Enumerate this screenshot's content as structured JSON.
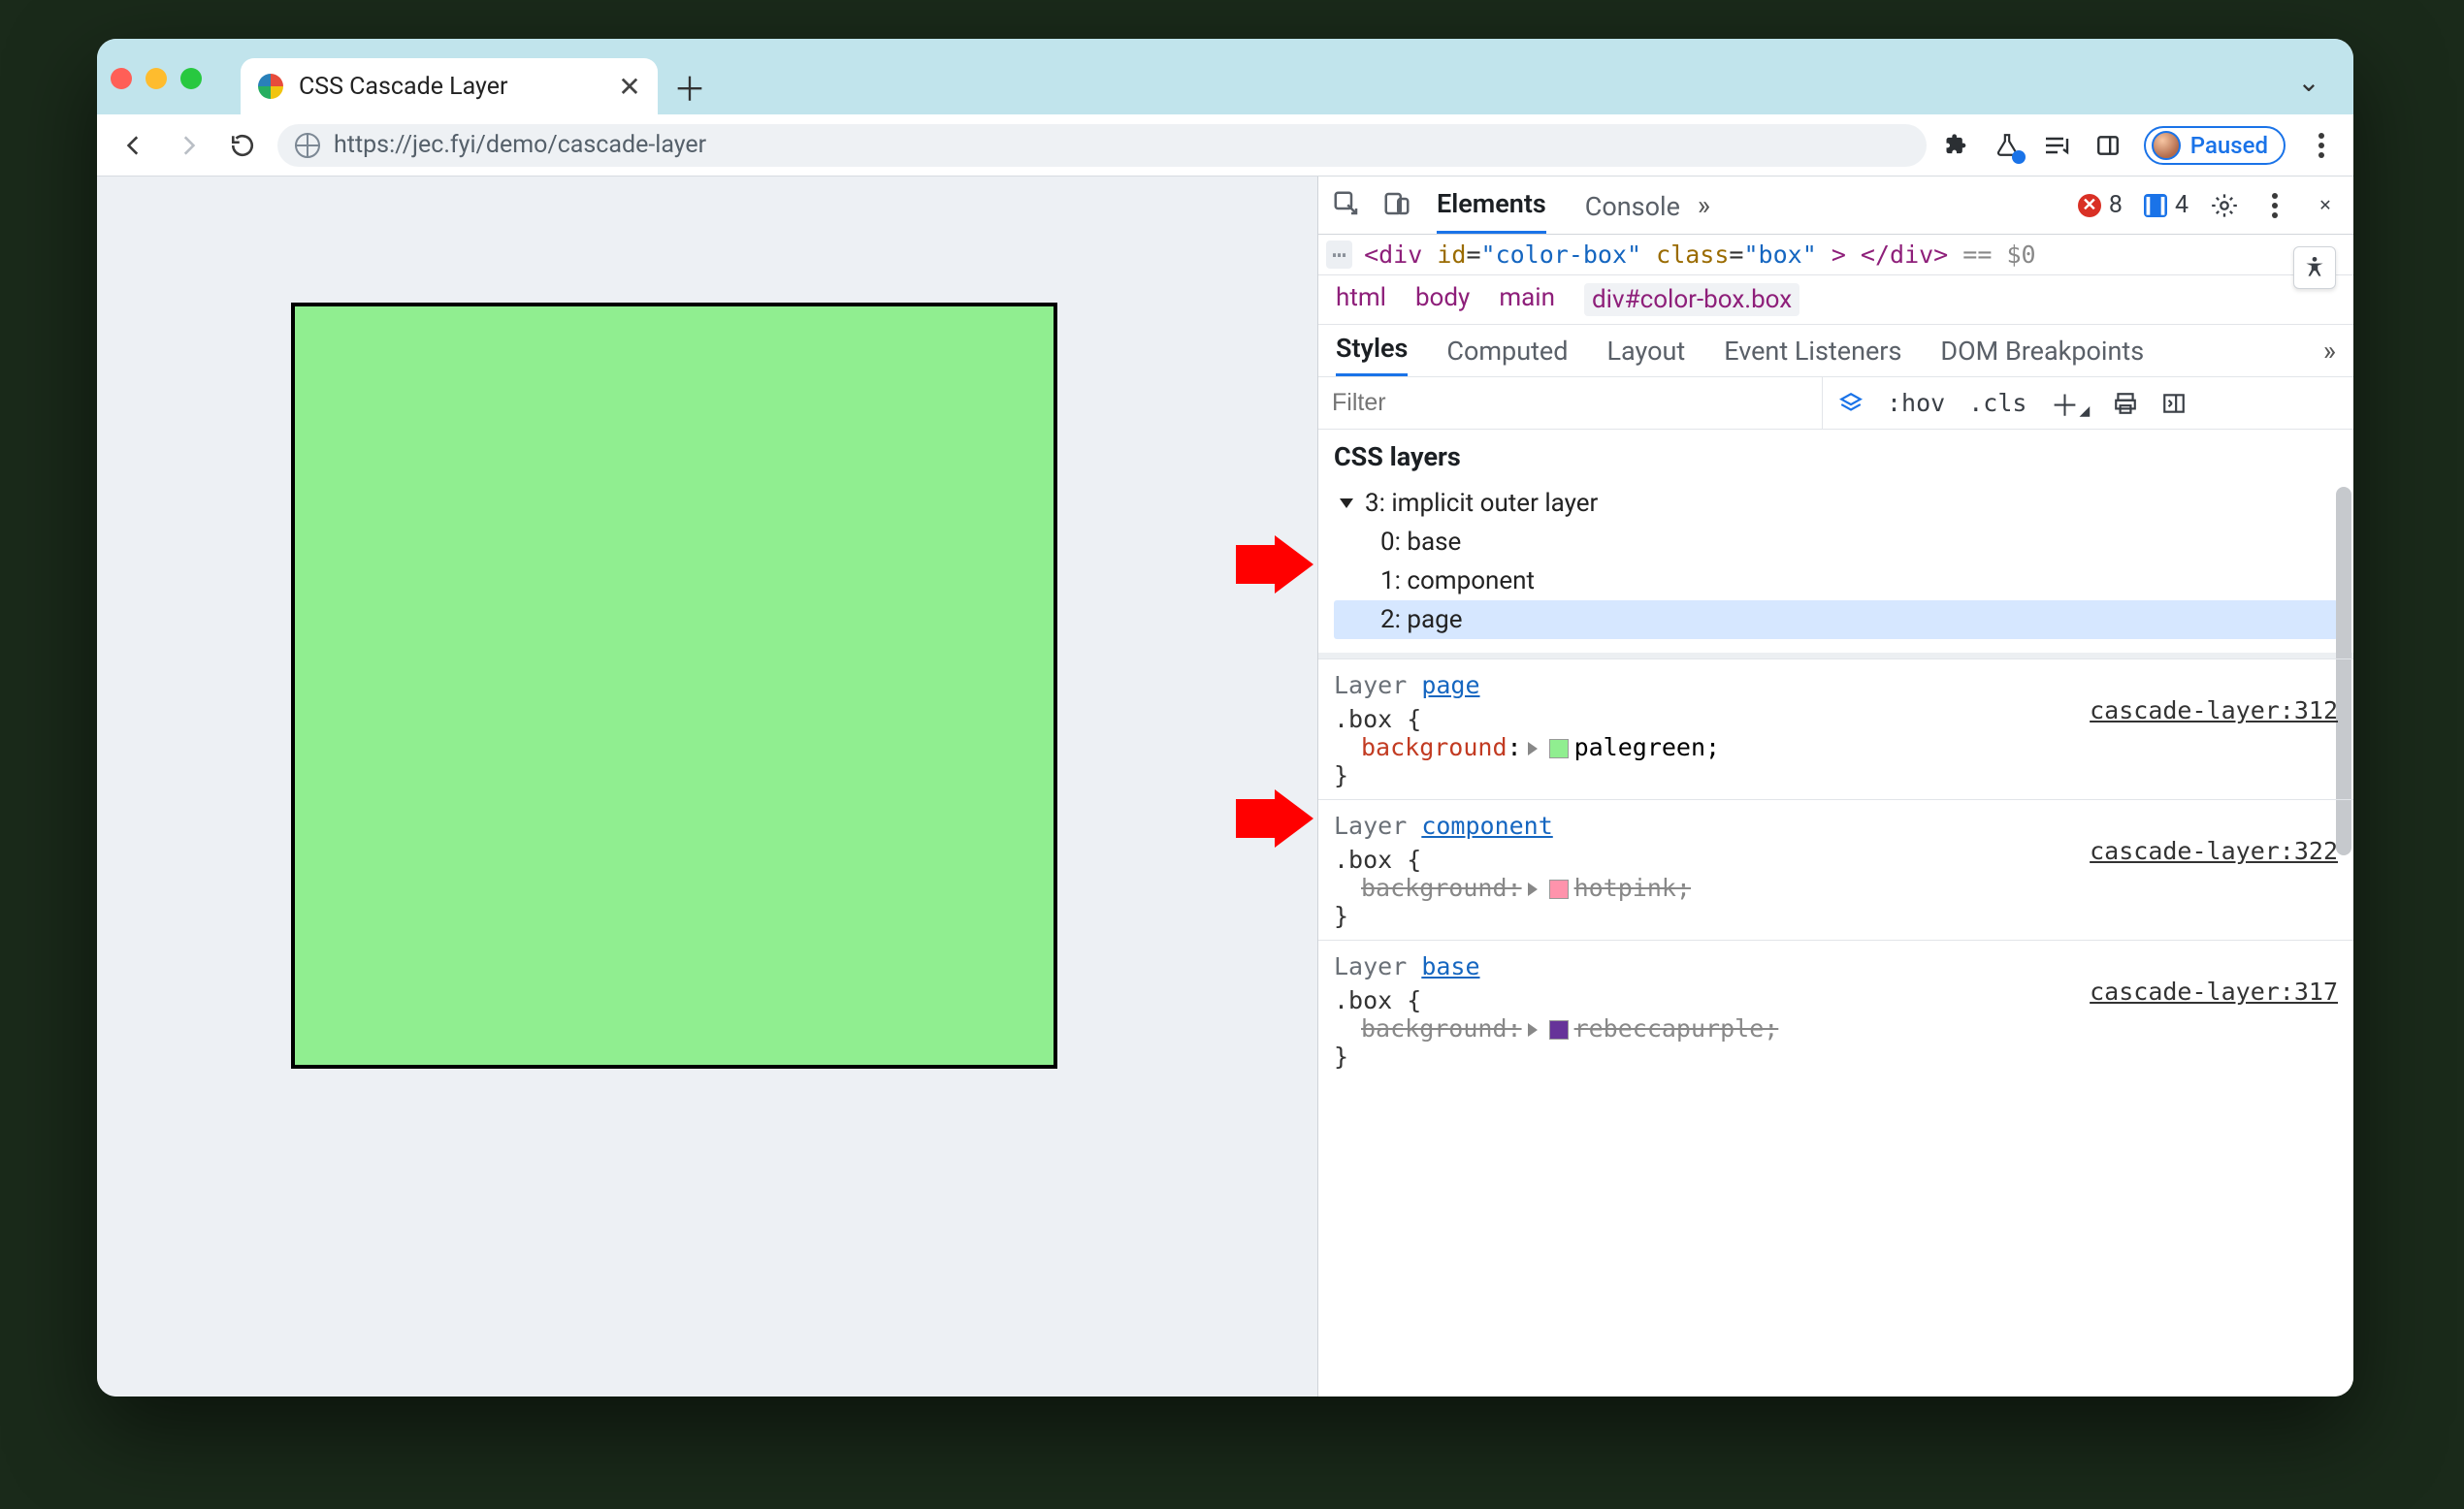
{
  "tab": {
    "title": "CSS Cascade Layer"
  },
  "url": "https://jec.fyi/demo/cascade-layer",
  "paused_label": "Paused",
  "devtools": {
    "tabs": {
      "elements": "Elements",
      "console": "Console"
    },
    "error_count": "8",
    "msg_count": "4",
    "dom_line": {
      "open": "<div",
      "id_attr": "id",
      "id_val": "\"color-box\"",
      "class_attr": "class",
      "class_val": "\"box\"",
      "close": "> </div>",
      "eq": "== $0"
    },
    "breadcrumb": [
      "html",
      "body",
      "main"
    ],
    "breadcrumb_sel_tag": "div",
    "breadcrumb_sel_rest": "#color-box.box",
    "styles_tabs": [
      "Styles",
      "Computed",
      "Layout",
      "Event Listeners",
      "DOM Breakpoints"
    ],
    "filter_placeholder": "Filter",
    "hov": ":hov",
    "cls": ".cls",
    "css_layers_title": "CSS layers",
    "tree_root": "3: implicit outer layer",
    "tree_children": [
      "0: base",
      "1: component",
      "2: page"
    ],
    "rules": [
      {
        "layer_prefix": "Layer ",
        "layer_link": "page",
        "selector": ".box {",
        "prop": "background",
        "swatch": "#90ee90",
        "value": "palegreen;",
        "close": "}",
        "source": "cascade-layer:312",
        "overridden": false
      },
      {
        "layer_prefix": "Layer ",
        "layer_link": "component",
        "selector": ".box {",
        "prop": "background",
        "swatch": "#ff93ac",
        "value": "hotpink;",
        "close": "}",
        "source": "cascade-layer:322",
        "overridden": true
      },
      {
        "layer_prefix": "Layer ",
        "layer_link": "base",
        "selector": ".box {",
        "prop": "background",
        "swatch": "#663399",
        "value": "rebeccapurple;",
        "close": "}",
        "source": "cascade-layer:317",
        "overridden": true
      }
    ]
  }
}
